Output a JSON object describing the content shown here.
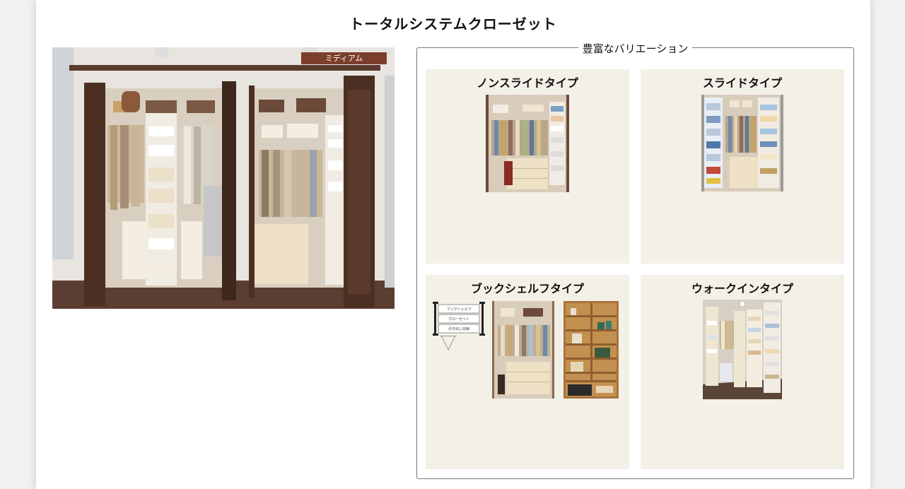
{
  "page": {
    "title": "トータルシステムクローゼット"
  },
  "hero": {
    "badge": "ミディアム"
  },
  "variations": {
    "legend": "豊富なバリエーション",
    "cards": [
      {
        "title": "ノンスライドタイプ"
      },
      {
        "title": "スライドタイプ"
      },
      {
        "title": "ブックシェルフタイプ",
        "diagram_labels": [
          "ブックシェルフ",
          "クローゼット",
          "引き出し収納"
        ]
      },
      {
        "title": "ウォークインタイプ"
      }
    ]
  },
  "colors": {
    "card_bg": "#f3f0e8",
    "badge_bg": "#7a3f2a",
    "door_brown": "#4a2f22",
    "shelf_cream": "#efe6d2"
  }
}
